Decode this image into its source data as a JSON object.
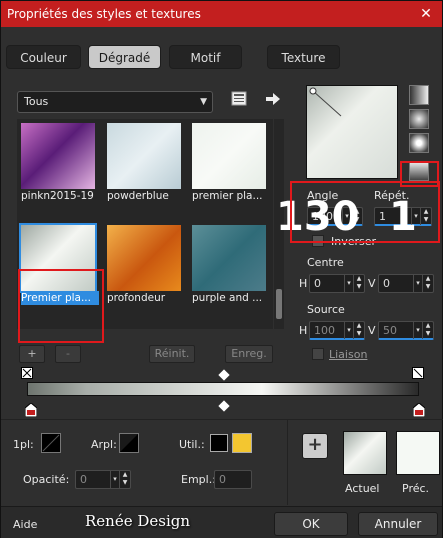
{
  "window": {
    "title": "Propriétés des styles et textures",
    "close": "✕"
  },
  "tabs": [
    {
      "label": "Couleur"
    },
    {
      "label": "Dégradé"
    },
    {
      "label": "Motif"
    },
    {
      "label": "Texture"
    }
  ],
  "category": {
    "selected": "Tous"
  },
  "gradients": [
    {
      "label": "pinkn2015-19"
    },
    {
      "label": "powderblue"
    },
    {
      "label": "premier pla..."
    },
    {
      "label": "Premier pla..."
    },
    {
      "label": "profondeur"
    },
    {
      "label": "purple and ..."
    }
  ],
  "library_buttons": {
    "add": "+",
    "remove": "-",
    "reset": "Réinit.",
    "save": "Enreg."
  },
  "angle": {
    "label": "Angle",
    "value": "130"
  },
  "repeat": {
    "label": "Répét.",
    "value": "1"
  },
  "invert": {
    "label": "Inverser"
  },
  "center": {
    "label": "Centre",
    "h_label": "H",
    "h_value": "0",
    "v_label": "V",
    "v_value": "0"
  },
  "source": {
    "label": "Source",
    "h_label": "H",
    "h_value": "100",
    "v_label": "V",
    "v_value": "50",
    "link_label": "Liaison"
  },
  "annotations": {
    "angle_big": "130",
    "repeat_big": "1"
  },
  "stops": {
    "one_pl_label": "1pl:",
    "arpl_label": "Arpl:",
    "util_label": "Util.:",
    "opacity_label": "Opacité:",
    "opacity_value": "0",
    "empl_label": "Empl.:",
    "empl_value": "0"
  },
  "preview": {
    "current_label": "Actuel",
    "previous_label": "Préc.",
    "add": "+"
  },
  "footer": {
    "help": "Aide",
    "brand": "Renée Design",
    "ok": "OK",
    "cancel": "Annuler"
  },
  "colors": {
    "accent": "#c31f1f",
    "selection": "#2f8ce0",
    "user_color": "#f3c630"
  }
}
